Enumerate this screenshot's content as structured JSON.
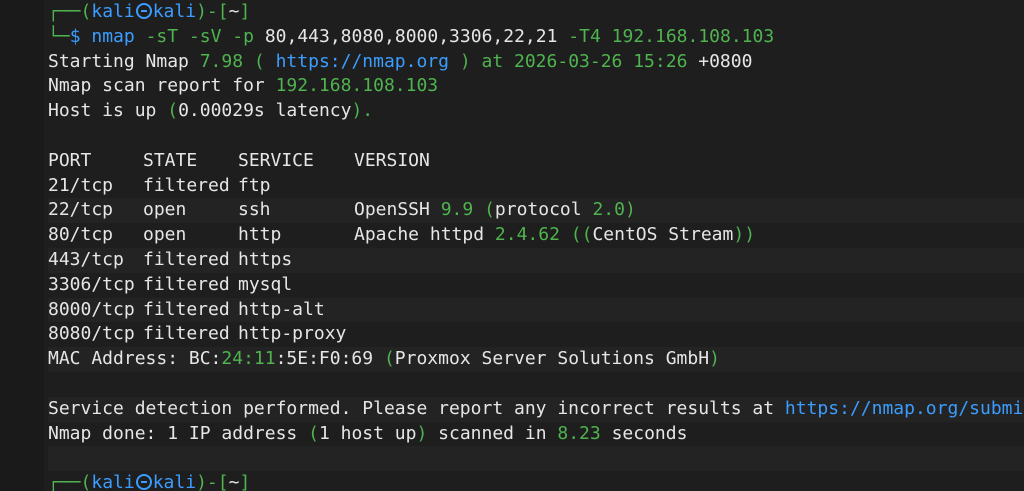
{
  "prompt1": {
    "top": "┌──(",
    "user": "kali",
    "host": "kali",
    "mid": ")-[",
    "dir": "~",
    "end": "]",
    "lead": "└─",
    "dollar": "$",
    "command": "nmap",
    "args": [
      {
        "text": "-sT",
        "color": "green"
      },
      {
        "text": "-sV",
        "color": "green"
      },
      {
        "text": "-p",
        "color": "green"
      },
      {
        "text": "80,443,8080,8000,3306,22,21",
        "color": "white"
      },
      {
        "text": "-T4",
        "color": "green"
      },
      {
        "text": "192.168.108.103",
        "color": "green"
      }
    ]
  },
  "output": {
    "starting": {
      "prefix": "Starting Nmap ",
      "version": "7.98",
      "open": " ( ",
      "url": "https://nmap.org",
      "close": " ) at 2026-03-26 ",
      "time": "15:26",
      "tz": " +0800"
    },
    "report": {
      "prefix": "Nmap scan report for ",
      "ip": "192.168.108.103"
    },
    "hostup": {
      "prefix": "Host is up ",
      "open": "(",
      "latency": "0.00029s latency",
      "close": ").",
      "suffix": ""
    },
    "headers": [
      "PORT",
      "STATE",
      "SERVICE",
      "VERSION"
    ],
    "rows": [
      {
        "port": "21/tcp",
        "state": "filtered",
        "service": "ftp",
        "version": ""
      },
      {
        "port": "22/tcp",
        "state": "open",
        "service": "ssh",
        "version": "OpenSSH 9.9 (protocol 2.0)"
      },
      {
        "port": "80/tcp",
        "state": "open",
        "service": "http",
        "version": "Apache httpd 2.4.62 ((CentOS Stream))"
      },
      {
        "port": "443/tcp",
        "state": "filtered",
        "service": "https",
        "version": ""
      },
      {
        "port": "3306/tcp",
        "state": "filtered",
        "service": "mysql",
        "version": ""
      },
      {
        "port": "8000/tcp",
        "state": "filtered",
        "service": "http-alt",
        "version": ""
      },
      {
        "port": "8080/tcp",
        "state": "filtered",
        "service": "http-proxy",
        "version": ""
      }
    ],
    "mac": {
      "prefix": "MAC Address: BC:",
      "green": "24:11",
      "rest": ":5E:F0:69 ",
      "open": "(",
      "vendor": "Proxmox Server Solutions GmbH",
      "close": ")"
    },
    "service_detection": {
      "text": "Service detection performed. Please report any incorrect results at ",
      "url": "https://nmap.org/submit/",
      "tail": " ."
    },
    "done": {
      "prefix": "Nmap done: 1 IP address ",
      "open": "(",
      "hosts": "1 host up",
      "close": ")",
      "mid": " scanned in ",
      "seconds": "8.23",
      "suffix": " seconds"
    }
  },
  "prompt2": {
    "top": "┌──(",
    "user": "kali",
    "host": "kali",
    "mid": ")-[",
    "dir": "~",
    "end": "]"
  },
  "colors": {
    "green": "#4fb34f",
    "blue": "#3b9dff",
    "text": "#e6e6e6",
    "background": "#1e1e1e"
  }
}
